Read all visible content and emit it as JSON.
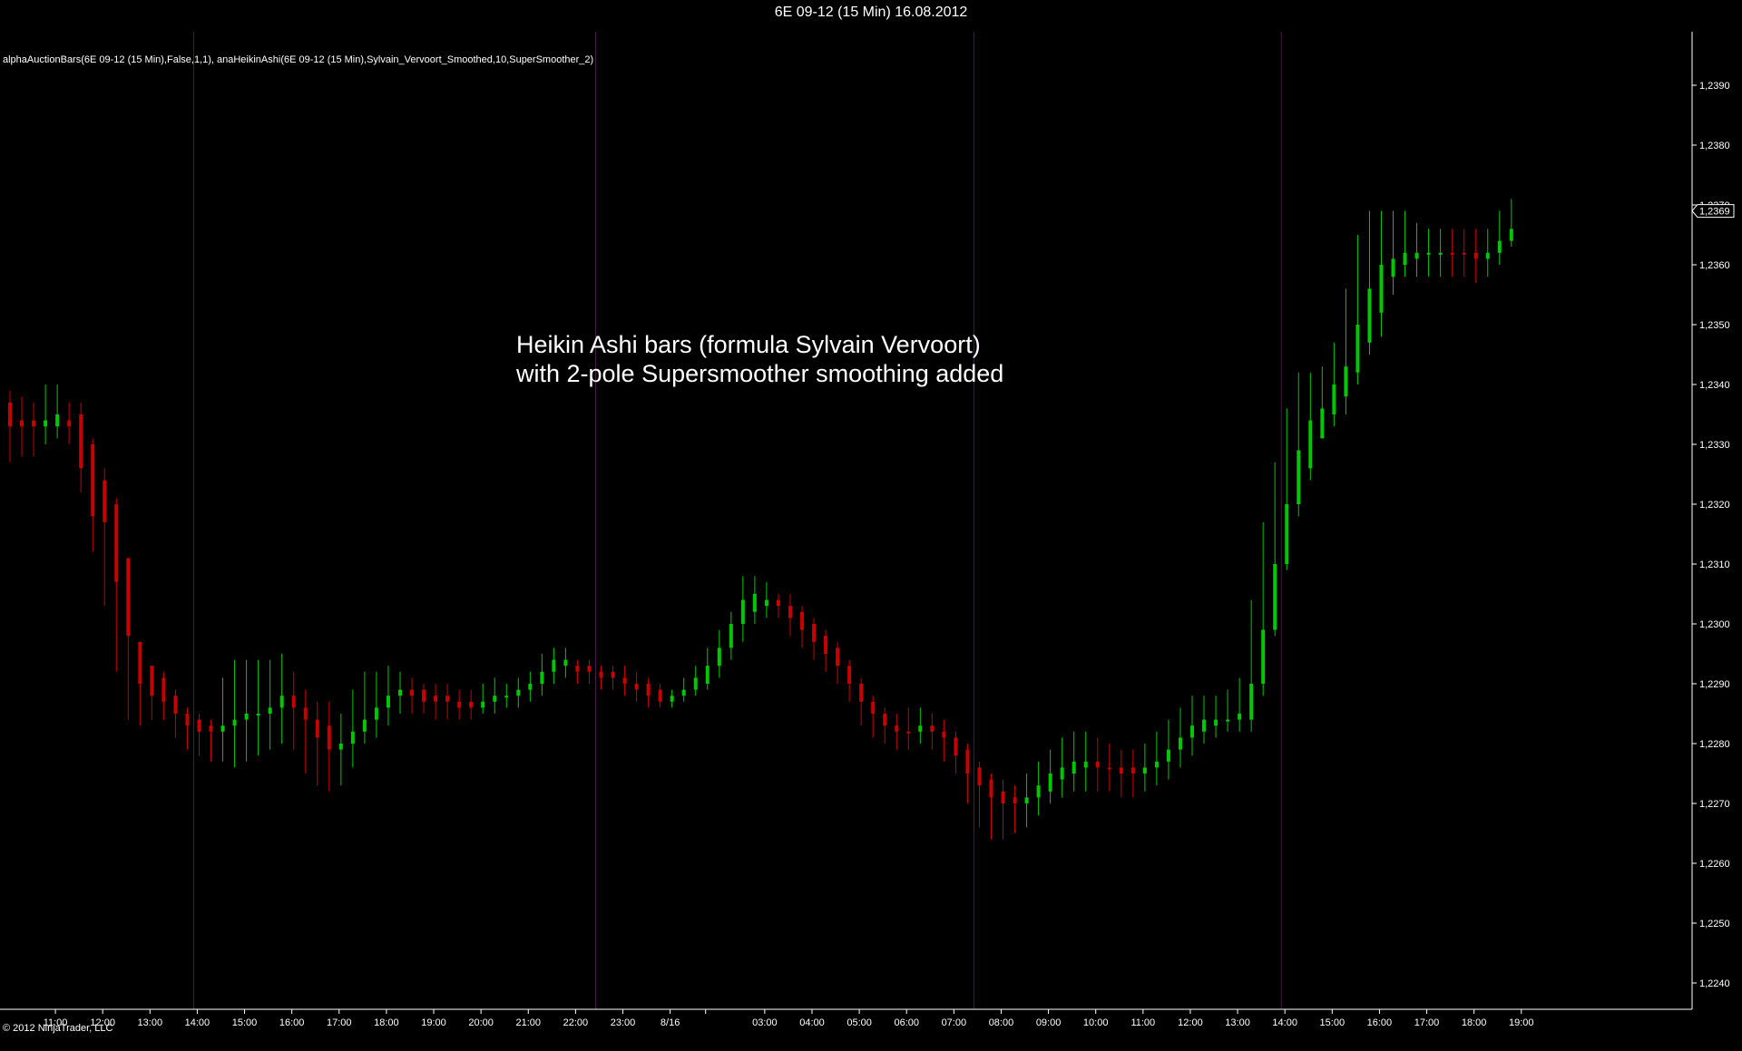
{
  "window": {
    "title": "6E 09-12 (15 Min)  16.08.2012"
  },
  "chart": {
    "indicator_label": "alphaAuctionBars(6E 09-12 (15 Min),False,1,1), anaHeikinAshi(6E 09-12 (15 Min),Sylvain_Vervoort_Smoothed,10,SuperSmoother_2)",
    "copyright": "© 2012 NinjaTrader, LLC",
    "annotation": {
      "line1": "Heikin Ashi bars (formula Sylvain Vervoort)",
      "line2": "with 2-pole Supersmoother smoothing added"
    }
  },
  "colors": {
    "up": "#00c800",
    "down": "#c80000",
    "background": "#000000",
    "axis": "#ffffff",
    "session_line": "#4a1a4a"
  },
  "chart_data": {
    "type": "candlestick",
    "title": "6E 09-12 (15 Min)  16.08.2012",
    "ylim": [
      1.2236,
      1.2402
    ],
    "y_ticks": [
      "1,2240",
      "1,2250",
      "1,2260",
      "1,2270",
      "1,2280",
      "1,2290",
      "1,2300",
      "1,2310",
      "1,2320",
      "1,2330",
      "1,2340",
      "1,2350",
      "1,2360",
      "1,2370",
      "1,2380",
      "1,2390"
    ],
    "y_tick_values": [
      1.224,
      1.225,
      1.226,
      1.227,
      1.228,
      1.229,
      1.23,
      1.231,
      1.232,
      1.233,
      1.234,
      1.235,
      1.236,
      1.237,
      1.238,
      1.239
    ],
    "x_ticks": [
      "11:00",
      "12:00",
      "13:00",
      "14:00",
      "15:00",
      "16:00",
      "17:00",
      "18:00",
      "19:00",
      "20:00",
      "21:00",
      "22:00",
      "23:00",
      "8/16",
      "03:00",
      "04:00",
      "05:00",
      "06:00",
      "07:00",
      "08:00",
      "09:00",
      "10:00",
      "11:00",
      "12:00",
      "13:00",
      "14:00",
      "15:00",
      "16:00",
      "17:00",
      "18:00",
      "19:00"
    ],
    "x_tick_bar_index": [
      2,
      6,
      10,
      14,
      18,
      22,
      26,
      30,
      34,
      38,
      42,
      46,
      50,
      54,
      62,
      66,
      70,
      74,
      78,
      82,
      86,
      90,
      94,
      98,
      102,
      106,
      110,
      114,
      118,
      122,
      126
    ],
    "session_breaks_bar_index": [
      16,
      50,
      82,
      108
    ],
    "last_price_label": "1,2369",
    "last_price": 1.2369,
    "candles": [
      [
        1.2337,
        1.2333,
        1.2339,
        1.2327,
        "down"
      ],
      [
        1.2334,
        1.2333,
        1.2338,
        1.2328,
        "down"
      ],
      [
        1.2334,
        1.2333,
        1.2337,
        1.2328,
        "down"
      ],
      [
        1.2333,
        1.2334,
        1.234,
        1.233,
        "up"
      ],
      [
        1.2333,
        1.2335,
        1.234,
        1.2331,
        "up"
      ],
      [
        1.2334,
        1.2333,
        1.2337,
        1.233,
        "down"
      ],
      [
        1.2335,
        1.2326,
        1.2337,
        1.2322,
        "down"
      ],
      [
        1.233,
        1.2318,
        1.2331,
        1.2312,
        "down"
      ],
      [
        1.2324,
        1.2317,
        1.2326,
        1.2303,
        "down"
      ],
      [
        1.232,
        1.2307,
        1.2321,
        1.2292,
        "down"
      ],
      [
        1.2311,
        1.2298,
        1.2311,
        1.2284,
        "down"
      ],
      [
        1.2297,
        1.229,
        1.2297,
        1.2283,
        "down"
      ],
      [
        1.2293,
        1.2288,
        1.2293,
        1.2284,
        "down"
      ],
      [
        1.2291,
        1.2287,
        1.2292,
        1.2284,
        "down"
      ],
      [
        1.2288,
        1.2285,
        1.2289,
        1.2281,
        "down"
      ],
      [
        1.2285,
        1.2283,
        1.2286,
        1.2279,
        "down"
      ],
      [
        1.2284,
        1.2282,
        1.2285,
        1.2278,
        "down"
      ],
      [
        1.2283,
        1.2282,
        1.2284,
        1.2277,
        "down"
      ],
      [
        1.2282,
        1.2283,
        1.2291,
        1.2277,
        "up"
      ],
      [
        1.2283,
        1.2284,
        1.2294,
        1.2276,
        "up"
      ],
      [
        1.2284,
        1.2285,
        1.2294,
        1.2277,
        "up"
      ],
      [
        1.2285,
        1.2285,
        1.2294,
        1.2278,
        "up"
      ],
      [
        1.2285,
        1.2286,
        1.2294,
        1.2279,
        "up"
      ],
      [
        1.2286,
        1.2288,
        1.2295,
        1.228,
        "up"
      ],
      [
        1.2288,
        1.2286,
        1.2292,
        1.2279,
        "down"
      ],
      [
        1.2286,
        1.2284,
        1.2289,
        1.2275,
        "down"
      ],
      [
        1.2284,
        1.2281,
        1.2287,
        1.2273,
        "down"
      ],
      [
        1.2283,
        1.2279,
        1.2287,
        1.2272,
        "down"
      ],
      [
        1.2279,
        1.228,
        1.2285,
        1.2273,
        "up"
      ],
      [
        1.228,
        1.2282,
        1.2289,
        1.2276,
        "up"
      ],
      [
        1.2282,
        1.2284,
        1.2292,
        1.228,
        "up"
      ],
      [
        1.2284,
        1.2286,
        1.2292,
        1.2281,
        "up"
      ],
      [
        1.2286,
        1.2288,
        1.2293,
        1.2283,
        "up"
      ],
      [
        1.2288,
        1.2289,
        1.2292,
        1.2285,
        "up"
      ],
      [
        1.2289,
        1.2288,
        1.2291,
        1.2285,
        "down"
      ],
      [
        1.2289,
        1.2287,
        1.229,
        1.2285,
        "down"
      ],
      [
        1.2288,
        1.2287,
        1.229,
        1.2284,
        "down"
      ],
      [
        1.2288,
        1.2287,
        1.229,
        1.2284,
        "down"
      ],
      [
        1.2287,
        1.2286,
        1.2289,
        1.2284,
        "down"
      ],
      [
        1.2287,
        1.2286,
        1.2289,
        1.2284,
        "down"
      ],
      [
        1.2286,
        1.2287,
        1.229,
        1.2285,
        "up"
      ],
      [
        1.2287,
        1.2288,
        1.2291,
        1.2285,
        "up"
      ],
      [
        1.2288,
        1.2288,
        1.229,
        1.2286,
        "up"
      ],
      [
        1.2288,
        1.2289,
        1.2291,
        1.2286,
        "up"
      ],
      [
        1.2289,
        1.229,
        1.2292,
        1.2287,
        "up"
      ],
      [
        1.229,
        1.2292,
        1.2295,
        1.2288,
        "up"
      ],
      [
        1.2292,
        1.2294,
        1.2296,
        1.229,
        "up"
      ],
      [
        1.2293,
        1.2294,
        1.2296,
        1.2291,
        "up"
      ],
      [
        1.2293,
        1.2292,
        1.2294,
        1.229,
        "down"
      ],
      [
        1.2293,
        1.2292,
        1.2294,
        1.229,
        "down"
      ],
      [
        1.2292,
        1.2291,
        1.2293,
        1.2289,
        "down"
      ],
      [
        1.2292,
        1.2291,
        1.2293,
        1.2289,
        "down"
      ],
      [
        1.2291,
        1.229,
        1.2293,
        1.2288,
        "down"
      ],
      [
        1.229,
        1.2289,
        1.2292,
        1.2287,
        "down"
      ],
      [
        1.229,
        1.2288,
        1.2291,
        1.2286,
        "down"
      ],
      [
        1.2289,
        1.2287,
        1.229,
        1.2286,
        "down"
      ],
      [
        1.2287,
        1.2288,
        1.2289,
        1.2286,
        "up"
      ],
      [
        1.2288,
        1.2289,
        1.2291,
        1.2287,
        "up"
      ],
      [
        1.2289,
        1.2291,
        1.2293,
        1.2288,
        "up"
      ],
      [
        1.229,
        1.2293,
        1.2296,
        1.2289,
        "up"
      ],
      [
        1.2293,
        1.2296,
        1.2299,
        1.2291,
        "up"
      ],
      [
        1.2296,
        1.23,
        1.2302,
        1.2294,
        "up"
      ],
      [
        1.23,
        1.2304,
        1.2308,
        1.2297,
        "up"
      ],
      [
        1.2302,
        1.2305,
        1.2308,
        1.23,
        "up"
      ],
      [
        1.2303,
        1.2304,
        1.2307,
        1.2301,
        "up"
      ],
      [
        1.2304,
        1.2303,
        1.2305,
        1.2301,
        "down"
      ],
      [
        1.2303,
        1.2301,
        1.2305,
        1.2298,
        "down"
      ],
      [
        1.2302,
        1.2299,
        1.2303,
        1.2296,
        "down"
      ],
      [
        1.23,
        1.2297,
        1.2301,
        1.2294,
        "down"
      ],
      [
        1.2298,
        1.2295,
        1.2299,
        1.2292,
        "down"
      ],
      [
        1.2296,
        1.2293,
        1.2297,
        1.229,
        "down"
      ],
      [
        1.2293,
        1.229,
        1.2294,
        1.2287,
        "down"
      ],
      [
        1.229,
        1.2287,
        1.2291,
        1.2283,
        "down"
      ],
      [
        1.2287,
        1.2285,
        1.2288,
        1.2281,
        "down"
      ],
      [
        1.2285,
        1.2283,
        1.2286,
        1.228,
        "down"
      ],
      [
        1.2283,
        1.2282,
        1.2285,
        1.2279,
        "down"
      ],
      [
        1.2282,
        1.2282,
        1.2286,
        1.2279,
        "down"
      ],
      [
        1.2282,
        1.2283,
        1.2286,
        1.228,
        "up"
      ],
      [
        1.2283,
        1.2282,
        1.2285,
        1.2279,
        "down"
      ],
      [
        1.2282,
        1.2281,
        1.2284,
        1.2277,
        "down"
      ],
      [
        1.2281,
        1.2278,
        1.2282,
        1.2275,
        "down"
      ],
      [
        1.2279,
        1.2275,
        1.228,
        1.227,
        "down"
      ],
      [
        1.2276,
        1.2273,
        1.2277,
        1.2266,
        "down"
      ],
      [
        1.2274,
        1.2271,
        1.2275,
        1.2264,
        "down"
      ],
      [
        1.2272,
        1.227,
        1.2274,
        1.2264,
        "down"
      ],
      [
        1.2271,
        1.227,
        1.2273,
        1.2265,
        "down"
      ],
      [
        1.227,
        1.2271,
        1.2275,
        1.2266,
        "up"
      ],
      [
        1.2271,
        1.2273,
        1.2277,
        1.2268,
        "up"
      ],
      [
        1.2272,
        1.2275,
        1.2279,
        1.227,
        "up"
      ],
      [
        1.2274,
        1.2276,
        1.2281,
        1.2271,
        "up"
      ],
      [
        1.2275,
        1.2277,
        1.2282,
        1.2272,
        "up"
      ],
      [
        1.2276,
        1.2277,
        1.2282,
        1.2272,
        "up"
      ],
      [
        1.2277,
        1.2276,
        1.2281,
        1.2272,
        "down"
      ],
      [
        1.2276,
        1.2276,
        1.228,
        1.2272,
        "down"
      ],
      [
        1.2276,
        1.2275,
        1.2279,
        1.2271,
        "down"
      ],
      [
        1.2276,
        1.2275,
        1.2279,
        1.2271,
        "down"
      ],
      [
        1.2275,
        1.2276,
        1.228,
        1.2272,
        "up"
      ],
      [
        1.2276,
        1.2277,
        1.2282,
        1.2273,
        "up"
      ],
      [
        1.2277,
        1.2279,
        1.2284,
        1.2274,
        "up"
      ],
      [
        1.2279,
        1.2281,
        1.2286,
        1.2276,
        "up"
      ],
      [
        1.2281,
        1.2283,
        1.2288,
        1.2278,
        "up"
      ],
      [
        1.2282,
        1.2284,
        1.2288,
        1.228,
        "up"
      ],
      [
        1.2283,
        1.2284,
        1.2288,
        1.2281,
        "up"
      ],
      [
        1.2284,
        1.2284,
        1.2289,
        1.2282,
        "up"
      ],
      [
        1.2284,
        1.2285,
        1.2291,
        1.2282,
        "up"
      ],
      [
        1.2284,
        1.229,
        1.2304,
        1.2282,
        "up"
      ],
      [
        1.229,
        1.2299,
        1.2317,
        1.2288,
        "up"
      ],
      [
        1.2299,
        1.231,
        1.2327,
        1.2298,
        "up"
      ],
      [
        1.231,
        1.232,
        1.2336,
        1.2309,
        "up"
      ],
      [
        1.232,
        1.2329,
        1.2342,
        1.2318,
        "up"
      ],
      [
        1.2326,
        1.2334,
        1.2342,
        1.2324,
        "up"
      ],
      [
        1.2331,
        1.2336,
        1.2343,
        1.2331,
        "up"
      ],
      [
        1.2335,
        1.234,
        1.2347,
        1.2333,
        "up"
      ],
      [
        1.2338,
        1.2343,
        1.2356,
        1.2335,
        "up"
      ],
      [
        1.2342,
        1.235,
        1.2365,
        1.234,
        "up"
      ],
      [
        1.2347,
        1.2356,
        1.2369,
        1.2345,
        "up"
      ],
      [
        1.2352,
        1.236,
        1.2369,
        1.2348,
        "up"
      ],
      [
        1.2358,
        1.2361,
        1.2369,
        1.2355,
        "up"
      ],
      [
        1.236,
        1.2362,
        1.2369,
        1.2358,
        "up"
      ],
      [
        1.2361,
        1.2362,
        1.2367,
        1.2358,
        "up"
      ],
      [
        1.2362,
        1.2362,
        1.2366,
        1.2358,
        "up"
      ],
      [
        1.2362,
        1.2362,
        1.2366,
        1.2358,
        "up"
      ],
      [
        1.2362,
        1.2362,
        1.2366,
        1.2358,
        "down"
      ],
      [
        1.2362,
        1.2362,
        1.2366,
        1.2358,
        "down"
      ],
      [
        1.2362,
        1.2361,
        1.2366,
        1.2357,
        "down"
      ],
      [
        1.2361,
        1.2362,
        1.2366,
        1.2358,
        "up"
      ],
      [
        1.2362,
        1.2364,
        1.2369,
        1.236,
        "up"
      ],
      [
        1.2364,
        1.2366,
        1.2371,
        1.2363,
        "up"
      ]
    ]
  }
}
